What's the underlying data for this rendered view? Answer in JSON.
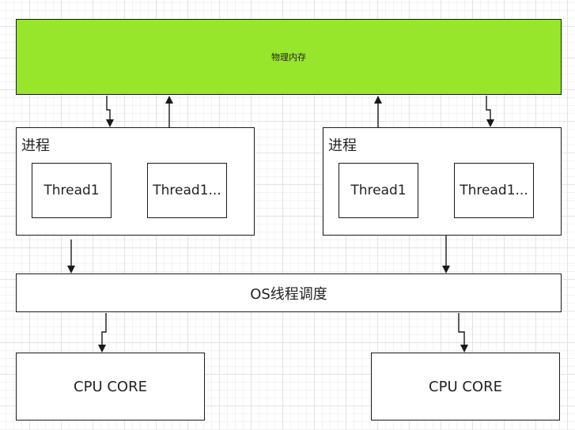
{
  "memory": {
    "label": "物理内存"
  },
  "processes": [
    {
      "label": "进程",
      "threads": [
        "Thread1",
        "Thread1..."
      ]
    },
    {
      "label": "进程",
      "threads": [
        "Thread1",
        "Thread1..."
      ]
    }
  ],
  "scheduler": {
    "label": "OS线程调度"
  },
  "cores": [
    {
      "label": "CPU CORE"
    },
    {
      "label": "CPU CORE"
    }
  ],
  "colors": {
    "memory_fill": "#98e62c",
    "stroke": "#1a1a1a"
  }
}
